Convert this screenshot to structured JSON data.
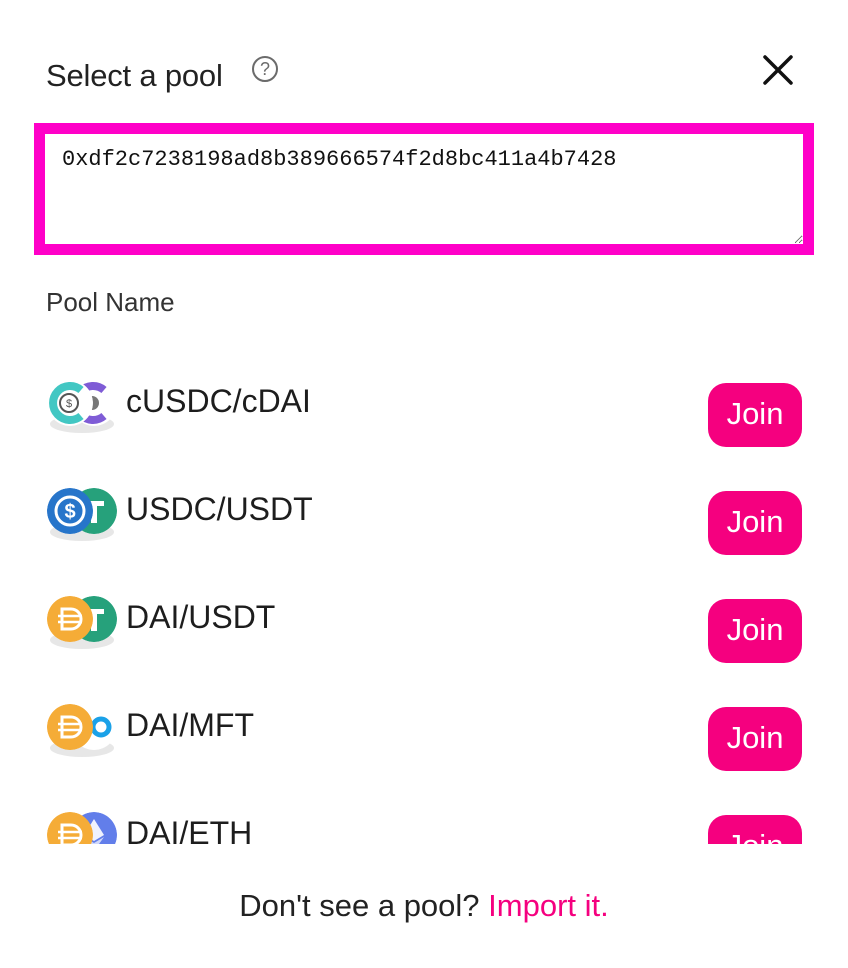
{
  "modal": {
    "title": "Select a pool",
    "help_icon": "question-circle-icon",
    "close_icon": "close-icon"
  },
  "search": {
    "value": "0xdf2c7238198ad8b389666574f2d8bc411a4b7428",
    "highlight_color": "#ff00c8"
  },
  "table": {
    "column_header": "Pool Name"
  },
  "pools": [
    {
      "name": "cUSDC/cDAI",
      "join_label": "Join",
      "icons": [
        "cusdc-icon",
        "cdai-icon"
      ]
    },
    {
      "name": "USDC/USDT",
      "join_label": "Join",
      "icons": [
        "usdc-icon",
        "usdt-icon"
      ]
    },
    {
      "name": "DAI/USDT",
      "join_label": "Join",
      "icons": [
        "dai-icon",
        "usdt-icon"
      ]
    },
    {
      "name": "DAI/MFT",
      "join_label": "Join",
      "icons": [
        "dai-icon",
        "mft-icon"
      ]
    },
    {
      "name": "DAI/ETH",
      "join_label": "Join",
      "icons": [
        "dai-icon",
        "eth-icon"
      ]
    }
  ],
  "footer": {
    "text": "Don't see a pool?",
    "link": "Import it."
  },
  "colors": {
    "accent": "#f5007f"
  }
}
